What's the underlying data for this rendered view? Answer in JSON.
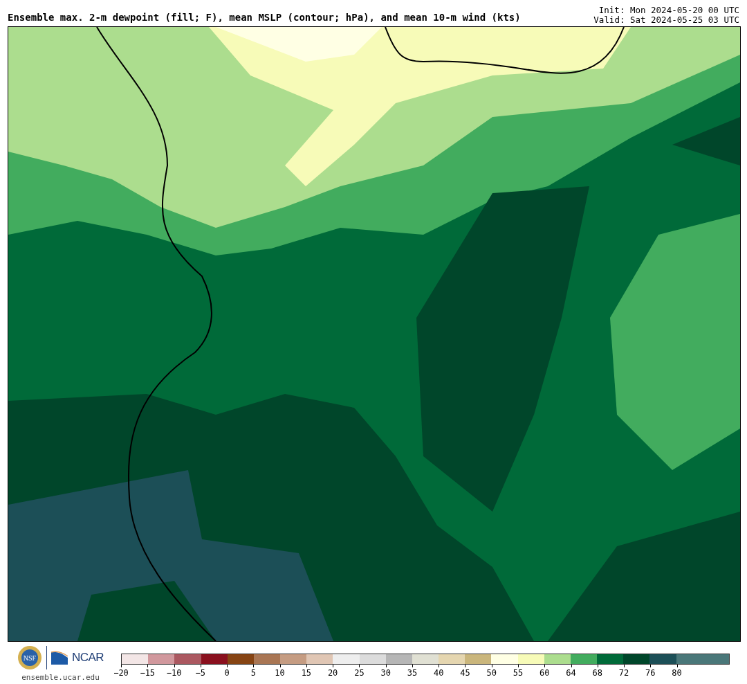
{
  "header": {
    "title": "Ensemble max. 2-m dewpoint (fill; F), mean MSLP (contour; hPa), and mean 10-m wind (kts)",
    "init": "Init: Mon 2024-05-20 00 UTC",
    "valid": "Valid: Sat 2024-05-25 03 UTC"
  },
  "footer": {
    "seal_text": "NSF",
    "logo_text": "NCAR",
    "site": "ensemble.ucar.edu"
  },
  "colorbar": {
    "segments": [
      {
        "color": "#f3e6e6",
        "tick": "−20"
      },
      {
        "color": "#d1989d",
        "tick": "−15"
      },
      {
        "color": "#ab5860",
        "tick": "−10"
      },
      {
        "color": "#8a101e",
        "tick": "−5"
      },
      {
        "color": "#864413",
        "tick": "0"
      },
      {
        "color": "#a97654",
        "tick": "5"
      },
      {
        "color": "#c59c82",
        "tick": "10"
      },
      {
        "color": "#e0c6b4",
        "tick": "15"
      },
      {
        "color": "#eeeeee",
        "tick": "20"
      },
      {
        "color": "#dcdcdc",
        "tick": "25"
      },
      {
        "color": "#b6b6b6",
        "tick": "30"
      },
      {
        "color": "#e0e0d3",
        "tick": "35"
      },
      {
        "color": "#e5d6b0",
        "tick": "40"
      },
      {
        "color": "#cab67c",
        "tick": "45"
      },
      {
        "color": "#ffffe4",
        "tick": "50"
      },
      {
        "color": "#f7fbb8",
        "tick": "55"
      },
      {
        "color": "#acdd8e",
        "tick": "60"
      },
      {
        "color": "#42ac5e",
        "tick": "64"
      },
      {
        "color": "#006a39",
        "tick": "68"
      },
      {
        "color": "#00462a",
        "tick": "72"
      },
      {
        "color": "#1c4f57",
        "tick": "76"
      },
      {
        "color": "#4a7779",
        "tick": "80"
      },
      {
        "color": "#4a7779"
      }
    ]
  }
}
